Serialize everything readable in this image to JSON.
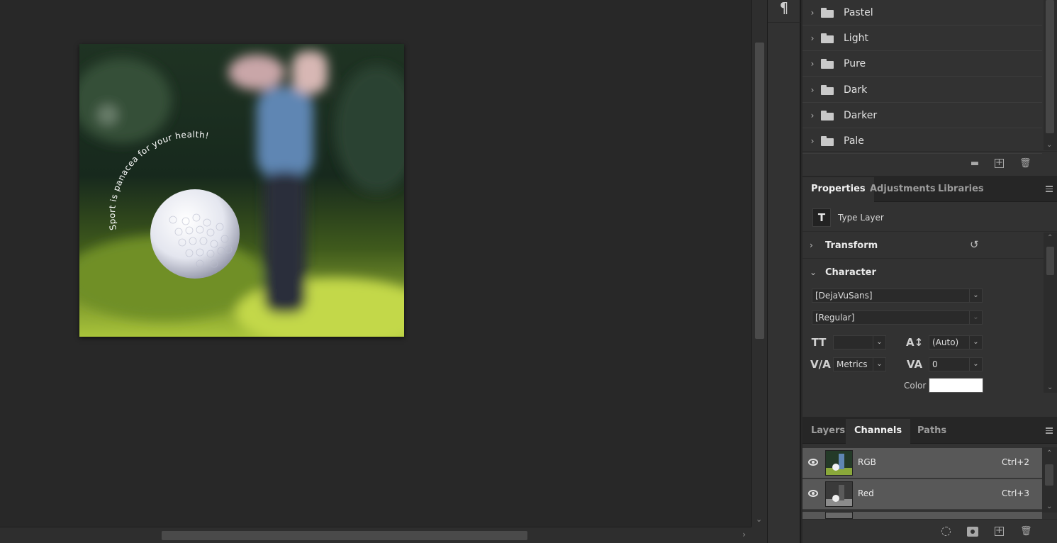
{
  "canvas": {
    "curved_text": "Sport is panacea for your health!"
  },
  "toolstrip": {
    "paragraph_glyph": "¶"
  },
  "swatches": {
    "folders": [
      "Pastel",
      "Light",
      "Pure",
      "Dark",
      "Darker",
      "Pale"
    ]
  },
  "properties": {
    "tabs": [
      "Properties",
      "Adjustments",
      "Libraries"
    ],
    "active_tab": "Properties",
    "layer_type": "Type Layer",
    "type_glyph": "T",
    "sections": {
      "transform": "Transform",
      "character": "Character"
    },
    "font_family": "[DejaVuSans]",
    "font_style": "[Regular]",
    "font_size": "",
    "leading": "(Auto)",
    "kerning": "Metrics",
    "tracking": "0",
    "color_label": "Color",
    "color_value": "#ffffff"
  },
  "channels_panel": {
    "tabs": [
      "Layers",
      "Channels",
      "Paths"
    ],
    "active_tab": "Channels",
    "rows": [
      {
        "name": "RGB",
        "shortcut": "Ctrl+2"
      },
      {
        "name": "Red",
        "shortcut": "Ctrl+3"
      }
    ]
  }
}
